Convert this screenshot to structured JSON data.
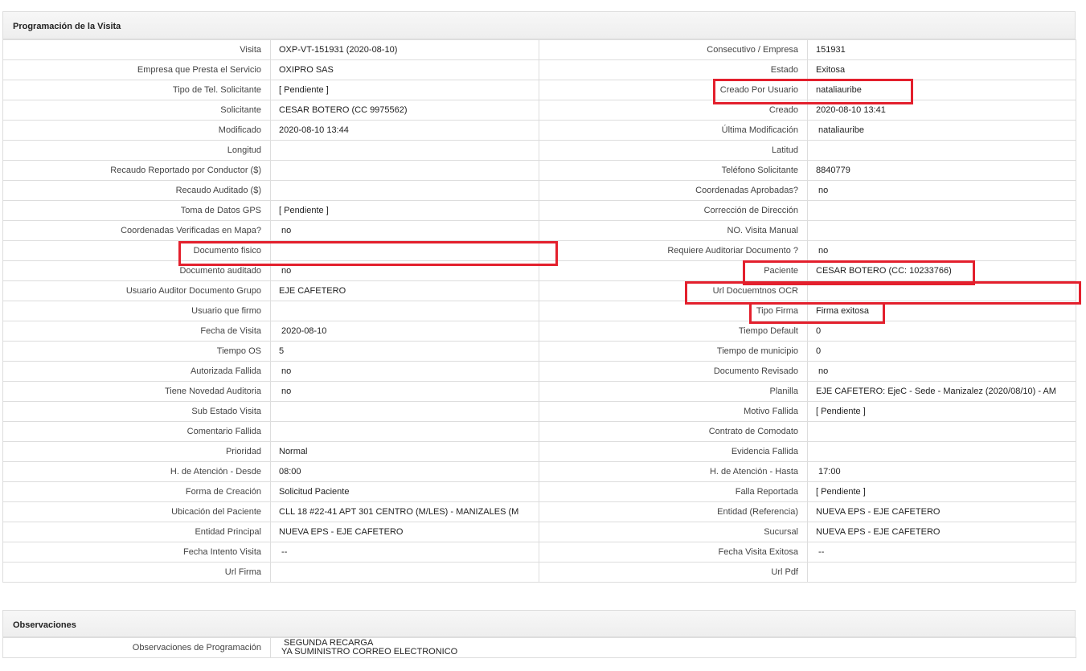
{
  "visit_panel": {
    "title": "Programación de la Visita",
    "rows": [
      [
        {
          "label": "Visita",
          "value": "OXP-VT-151931 (2020-08-10)"
        },
        {
          "label": "Consecutivo / Empresa",
          "value": "151931"
        }
      ],
      [
        {
          "label": "Empresa que Presta el Servicio",
          "value": "OXIPRO SAS"
        },
        {
          "label": "Estado",
          "value": "Exitosa"
        }
      ],
      [
        {
          "label": "Tipo de Tel. Solicitante",
          "value": "[ Pendiente ]"
        },
        {
          "label": "Creado Por Usuario",
          "value": "nataliauribe"
        }
      ],
      [
        {
          "label": "Solicitante",
          "value": "CESAR BOTERO (CC 9975562)"
        },
        {
          "label": "Creado",
          "value": "2020-08-10 13:41"
        }
      ],
      [
        {
          "label": "Modificado",
          "value": "2020-08-10 13:44"
        },
        {
          "label": "Última Modificación",
          "value": " nataliauribe"
        }
      ],
      [
        {
          "label": "Longitud",
          "value": ""
        },
        {
          "label": "Latitud",
          "value": ""
        }
      ],
      [
        {
          "label": "Recaudo Reportado por Conductor ($)",
          "value": ""
        },
        {
          "label": "Teléfono Solicitante",
          "value": "8840779"
        }
      ],
      [
        {
          "label": "Recaudo Auditado ($)",
          "value": ""
        },
        {
          "label": "Coordenadas Aprobadas?",
          "value": " no"
        }
      ],
      [
        {
          "label": "Toma de Datos GPS",
          "value": "[ Pendiente ]"
        },
        {
          "label": "Corrección de Dirección",
          "value": ""
        }
      ],
      [
        {
          "label": "Coordenadas Verificadas en Mapa?",
          "value": " no"
        },
        {
          "label": "NO. Visita Manual",
          "value": ""
        }
      ],
      [
        {
          "label": "Documento fisico",
          "value": ""
        },
        {
          "label": "Requiere Auditoriar Documento ?",
          "value": " no"
        }
      ],
      [
        {
          "label": "Documento auditado",
          "value": " no"
        },
        {
          "label": "Paciente",
          "value": "CESAR BOTERO (CC: 10233766)"
        }
      ],
      [
        {
          "label": "Usuario Auditor Documento Grupo",
          "value": "EJE CAFETERO"
        },
        {
          "label": "Url Docuemtnos OCR",
          "value": ""
        }
      ],
      [
        {
          "label": "Usuario que firmo",
          "value": ""
        },
        {
          "label": "Tipo Firma",
          "value": "Firma exitosa"
        }
      ],
      [
        {
          "label": "Fecha de Visita",
          "value": " 2020-08-10"
        },
        {
          "label": "Tiempo Default",
          "value": "0"
        }
      ],
      [
        {
          "label": "Tiempo OS",
          "value": "5"
        },
        {
          "label": "Tiempo de municipio",
          "value": "0"
        }
      ],
      [
        {
          "label": "Autorizada Fallida",
          "value": " no"
        },
        {
          "label": "Documento Revisado",
          "value": " no"
        }
      ],
      [
        {
          "label": "Tiene Novedad Auditoria",
          "value": " no"
        },
        {
          "label": "Planilla",
          "value": "EJE CAFETERO: EjeC - Sede - Manizalez (2020/08/10) - AM"
        }
      ],
      [
        {
          "label": "Sub Estado Visita",
          "value": ""
        },
        {
          "label": "Motivo Fallida",
          "value": "[ Pendiente ]"
        }
      ],
      [
        {
          "label": "Comentario Fallida",
          "value": ""
        },
        {
          "label": "Contrato de Comodato",
          "value": ""
        }
      ],
      [
        {
          "label": "Prioridad",
          "value": "Normal"
        },
        {
          "label": "Evidencia Fallida",
          "value": ""
        }
      ],
      [
        {
          "label": "H. de Atención - Desde",
          "value": "08:00"
        },
        {
          "label": "H. de Atención - Hasta",
          "value": " 17:00"
        }
      ],
      [
        {
          "label": "Forma de Creación",
          "value": "Solicitud Paciente"
        },
        {
          "label": "Falla Reportada",
          "value": "[ Pendiente ]"
        }
      ],
      [
        {
          "label": "Ubicación del Paciente",
          "value": "CLL 18 #22-41 APT 301 CENTRO (M/LES) - MANIZALES (M"
        },
        {
          "label": "Entidad (Referencia)",
          "value": "NUEVA EPS - EJE CAFETERO"
        }
      ],
      [
        {
          "label": "Entidad Principal",
          "value": "NUEVA EPS - EJE CAFETERO"
        },
        {
          "label": "Sucursal",
          "value": "NUEVA EPS - EJE CAFETERO"
        }
      ],
      [
        {
          "label": "Fecha Intento Visita",
          "value": " --"
        },
        {
          "label": "Fecha Visita Exitosa",
          "value": " --"
        }
      ],
      [
        {
          "label": "Url Firma",
          "value": ""
        },
        {
          "label": "Url Pdf",
          "value": ""
        }
      ]
    ]
  },
  "observations_panel": {
    "title": "Observaciones",
    "label": "Observaciones de Programación",
    "line1": " SEGUNDA RECARGA",
    "line2": "YA SUMINISTRO CORREO ELECTRONICO"
  },
  "highlight_color": "#e3202d"
}
